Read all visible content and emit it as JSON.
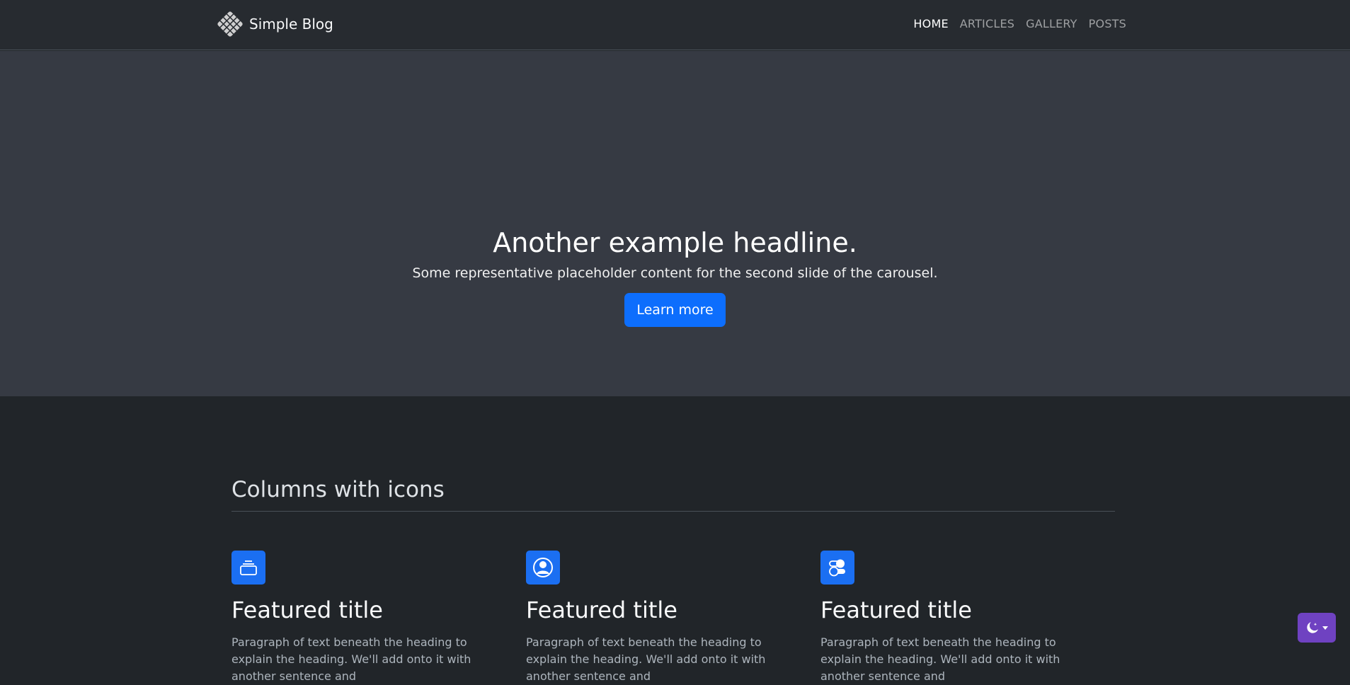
{
  "nav": {
    "brand": "Simple Blog",
    "logo_icon": "woven-grid-logo-icon",
    "links": [
      {
        "label": "HOME",
        "active": true
      },
      {
        "label": "ARTICLES",
        "active": false
      },
      {
        "label": "GALLERY",
        "active": false
      },
      {
        "label": "POSTS",
        "active": false
      }
    ]
  },
  "hero": {
    "title": "Another example headline.",
    "subtitle": "Some representative placeholder content for the second slide of the carousel.",
    "button_label": "Learn more"
  },
  "features": {
    "heading": "Columns with icons",
    "columns": [
      {
        "icon": "collection-icon",
        "title": "Featured title",
        "text": "Paragraph of text beneath the heading to explain the heading. We'll add onto it with another sentence and"
      },
      {
        "icon": "person-circle-icon",
        "title": "Featured title",
        "text": "Paragraph of text beneath the heading to explain the heading. We'll add onto it with another sentence and"
      },
      {
        "icon": "toggles-icon",
        "title": "Featured title",
        "text": "Paragraph of text beneath the heading to explain the heading. We'll add onto it with another sentence and"
      }
    ]
  },
  "theme_toggle": {
    "icon": "moon-stars-icon"
  },
  "colors": {
    "navbar_bg": "#272b30",
    "hero_bg": "#363a43",
    "page_bg": "#212529",
    "primary": "#0d6efd",
    "theme_toggle_bg": "#6f42c1"
  }
}
